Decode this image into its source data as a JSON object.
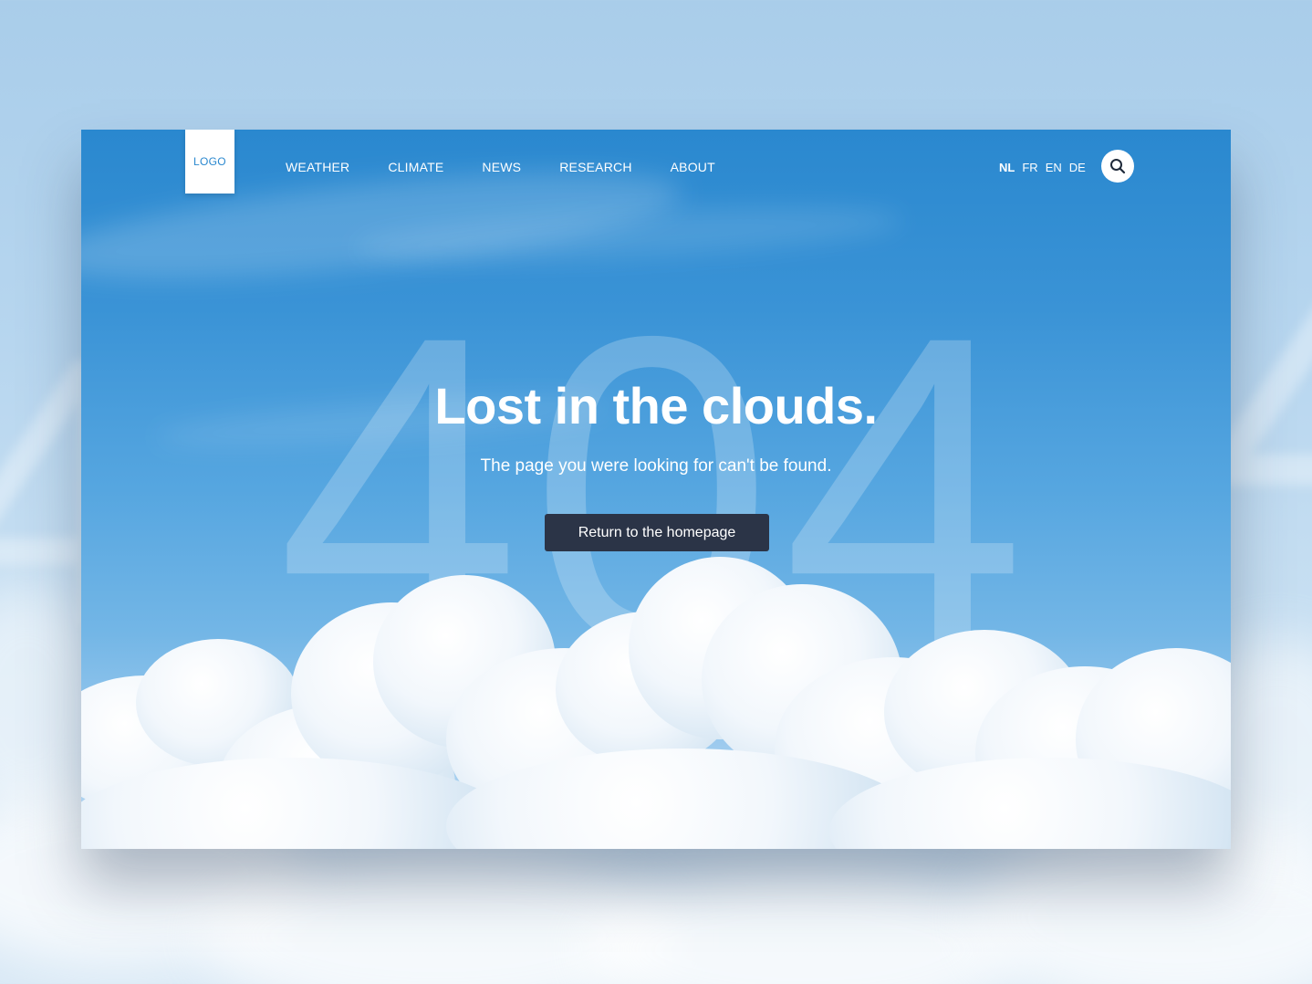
{
  "header": {
    "logo_label": "LOGO",
    "nav": [
      {
        "label": "WEATHER"
      },
      {
        "label": "CLIMATE"
      },
      {
        "label": "NEWS"
      },
      {
        "label": "RESEARCH"
      },
      {
        "label": "ABOUT"
      }
    ],
    "languages": [
      {
        "code": "NL",
        "active": true
      },
      {
        "code": "FR",
        "active": false
      },
      {
        "code": "EN",
        "active": false
      },
      {
        "code": "DE",
        "active": false
      }
    ],
    "search_icon": "search-icon"
  },
  "hero": {
    "background_number": "404",
    "title": "Lost in the clouds.",
    "subtitle": "The page you were looking for can't be found.",
    "button_label": "Return to the homepage"
  },
  "colors": {
    "sky_top": "#2a88cf",
    "button_bg": "#2b3447",
    "text": "#ffffff",
    "logo_text": "#2a88cf"
  }
}
